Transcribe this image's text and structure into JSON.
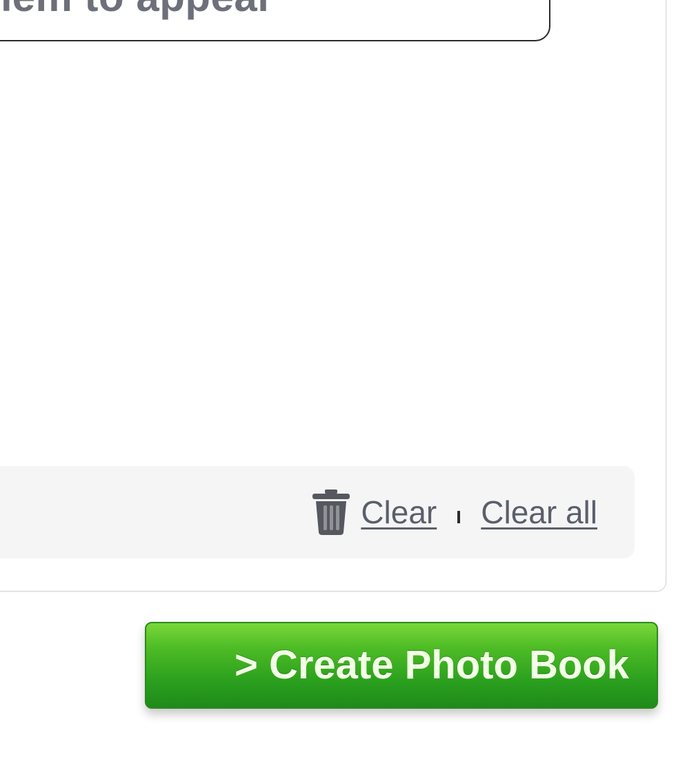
{
  "dropzone": {
    "instruction_text": "them to appear"
  },
  "toolbar": {
    "clear_label": "Clear",
    "clear_all_label": "Clear all"
  },
  "actions": {
    "create_photo_book_label": "> Create Photo Book"
  },
  "icons": {
    "trash": "trash-icon"
  },
  "colors": {
    "cta_green": "#2a9f1e",
    "link_gray": "#5a5f6b",
    "instruction_gray": "#6d7079"
  }
}
